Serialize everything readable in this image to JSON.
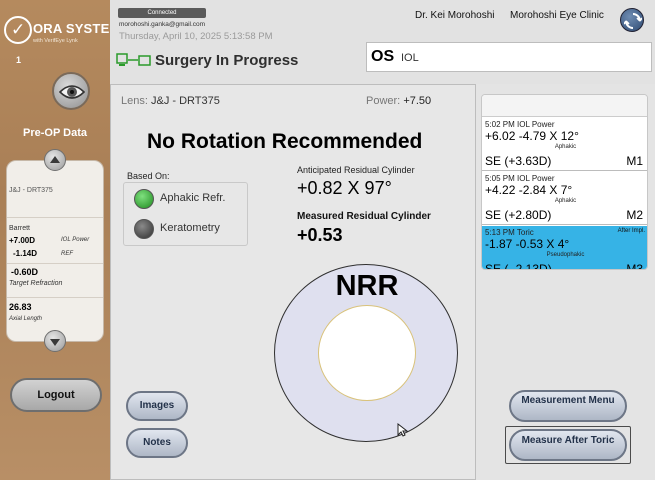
{
  "sidebar": {
    "brand": "ORA SYSTEM.",
    "brand_sub": "with VerifEye Lynk",
    "slot_number": "1",
    "preop_title": "Pre-OP Data",
    "preop": {
      "lens": "J&J - DRT375",
      "formula": "Barrett",
      "iol_power_value": "+7.00D",
      "iol_power_label": "IOL Power",
      "ref_value": "-1.14D",
      "ref_label": "REF",
      "target_value": "-0.60D",
      "target_label": "Target Refraction",
      "axial_value": "26.83",
      "axial_label": "Axial Length"
    },
    "logout_label": "Logout"
  },
  "header": {
    "connection_status": "Connected",
    "user_email": "morohoshi.ganka@gmail.com",
    "datetime": "Thursday, April 10, 2025 5:13:58 PM",
    "doctor": "Dr. Kei Morohoshi",
    "clinic": "Morohoshi Eye Clinic",
    "status": "Surgery In Progress",
    "eye": "OS",
    "procedure": "IOL"
  },
  "main": {
    "lens_label": "Lens:",
    "lens_value": "J&J - DRT375",
    "power_label": "Power:",
    "power_value": "+7.50",
    "recommendation": "No Rotation Recommended",
    "based_on_label": "Based On:",
    "based_on": [
      {
        "label": "Aphakic Refr.",
        "active": true
      },
      {
        "label": "Keratometry",
        "active": false
      }
    ],
    "anticipated_label": "Anticipated Residual Cylinder",
    "anticipated_value": "+0.82 X 97°",
    "measured_label": "Measured Residual Cylinder",
    "measured_value": "+0.53",
    "nrr_label": "NRR",
    "images_label": "Images",
    "notes_label": "Notes"
  },
  "measurements": [
    {
      "time": "5:02 PM IOL Power",
      "rx": "+6.02  -4.79 X 12°",
      "state": "Aphakic",
      "se": "SE (+3.63D)",
      "id": "M1",
      "after": "",
      "selected": false
    },
    {
      "time": "5:05 PM IOL Power",
      "rx": "+4.22  -2.84 X 7°",
      "state": "Aphakic",
      "se": "SE (+2.80D)",
      "id": "M2",
      "after": "",
      "selected": false
    },
    {
      "time": "5:13 PM Toric",
      "rx": " -1.87  -0.53 X 4°",
      "state": "Pseudophakic",
      "se": "SE ( -2.13D)",
      "id": "M3",
      "after": "After Impl.",
      "selected": true
    }
  ],
  "right_buttons": {
    "measurement_menu": "Measurement Menu",
    "measure_after_toric": "Measure After Toric"
  },
  "colors": {
    "sidebar": "#b0865c",
    "selected_row": "#36b3e6",
    "led_green": "#1f8a1f"
  }
}
